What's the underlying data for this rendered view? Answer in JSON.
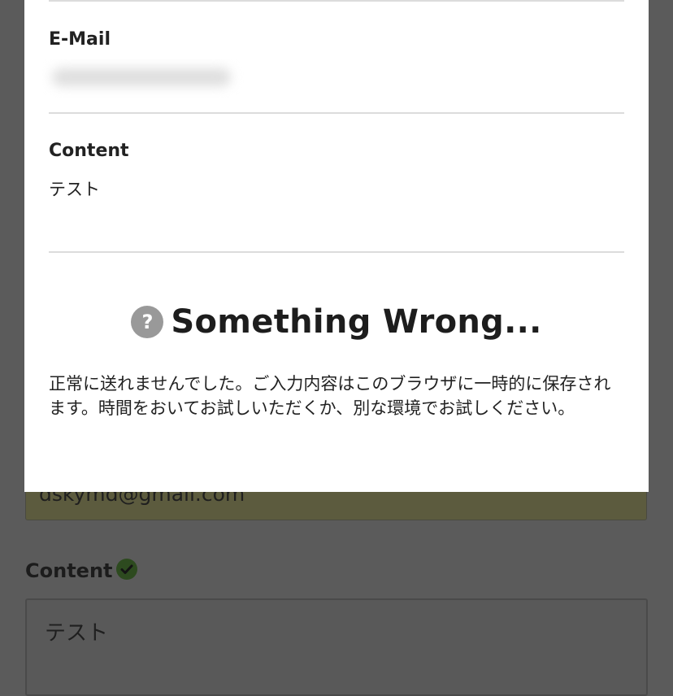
{
  "background_form": {
    "email_value": "dskymd@gmail.com",
    "content_label": "Content",
    "content_value": "テスト",
    "valid_icon": "check-circle-icon",
    "valid_color": "#2d4a1f"
  },
  "modal": {
    "email_label": "E-Mail",
    "content_label": "Content",
    "content_value": "テスト",
    "error": {
      "icon": "question-circle-icon",
      "title": "Something Wrong...",
      "message": "正常に送れませんでした。ご入力内容はこのブラウザに一時的に保存されます。時間をおいてお試しいただくか、別な環境でお試しください。"
    }
  }
}
